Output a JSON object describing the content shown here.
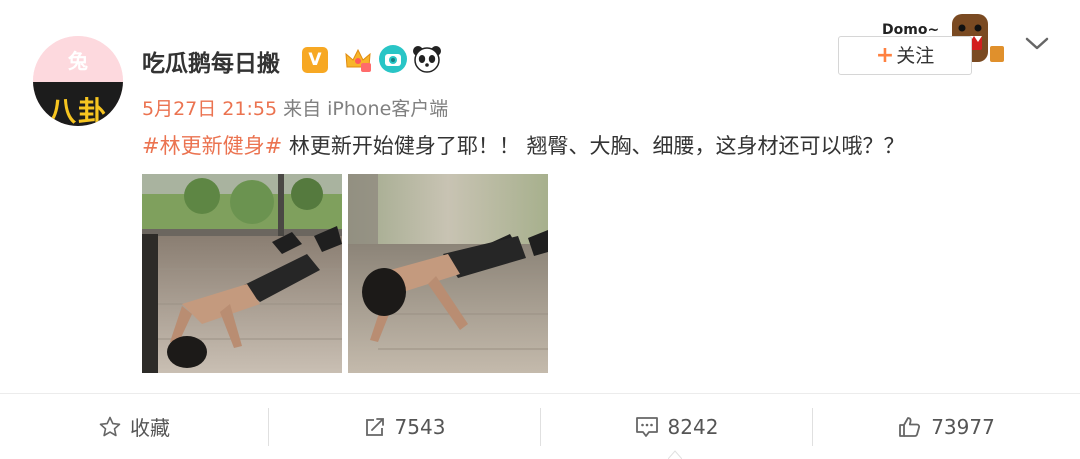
{
  "post": {
    "author": {
      "name": "吃瓜鹅每日搬",
      "verified_badge": "V",
      "avatar_mark": "兔",
      "avatar_text": "八卦"
    },
    "meta": {
      "time": "5月27日 21:55",
      "source": "来自 iPhone客户端"
    },
    "follow": {
      "label": "关注",
      "plus": "+",
      "sticker_text": "Domo~"
    },
    "content": {
      "hashtag": "#林更新健身#",
      "text": " 林更新开始健身了耶！！ 翘臀、大胸、细腰，这身材还可以哦？？"
    },
    "images": [
      {
        "name": "pushup-photo-1"
      },
      {
        "name": "pushup-photo-2"
      }
    ]
  },
  "actions": {
    "favorite": {
      "label": "收藏",
      "icon": "star-icon"
    },
    "repost": {
      "count": "7543",
      "icon": "share-icon"
    },
    "comment": {
      "count": "8242",
      "icon": "comment-icon"
    },
    "like": {
      "count": "73977",
      "icon": "thumbs-up-icon"
    }
  },
  "colors": {
    "accent": "#eb7350",
    "follow_plus": "#ff8140",
    "verified": "#f7a823"
  }
}
